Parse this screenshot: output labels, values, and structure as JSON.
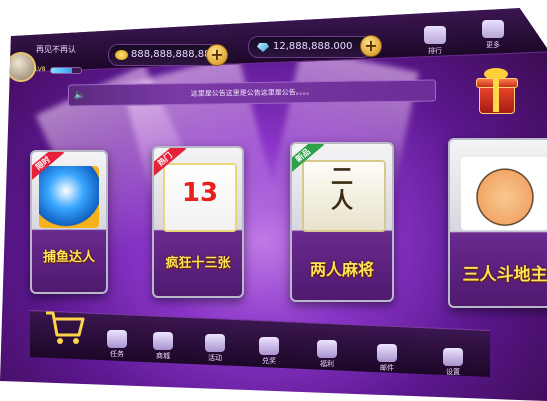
{
  "player": {
    "name": "再见不再认",
    "level_label": "LV8",
    "level_progress": 0.7
  },
  "currency": {
    "gold": "888,888,888,888",
    "diamonds": "12,888,888.000",
    "plus_label": "+"
  },
  "top_icons": [
    {
      "icon": "crown-icon",
      "label": "排行"
    },
    {
      "icon": "user-icon",
      "label": "更多"
    }
  ],
  "notice": {
    "text": "这里是公告这里是公告这里是公告。。。。"
  },
  "games": [
    {
      "tag": "限时",
      "title": "捕鱼达人",
      "icon": "fish-icon"
    },
    {
      "tag": "热门",
      "title": "疯狂十三张",
      "icon": "playing-card-icon"
    },
    {
      "tag": "新品",
      "title": "两人麻将",
      "icon": "mahjong-tile-icon"
    },
    {
      "tag": "",
      "title": "三人斗地主",
      "icon": "character-face-icon"
    }
  ],
  "bottom_nav": [
    {
      "icon": "task-icon",
      "label": "任务"
    },
    {
      "icon": "shop-icon",
      "label": "商城"
    },
    {
      "icon": "gift-icon",
      "label": "活动"
    },
    {
      "icon": "medal-icon",
      "label": "兑奖"
    },
    {
      "icon": "bag-icon",
      "label": "福利"
    },
    {
      "icon": "mail-icon",
      "label": "邮件"
    },
    {
      "icon": "gear-icon",
      "label": "设置"
    }
  ],
  "colors": {
    "accent_gold": "#ffe35a",
    "bg_purple": "#8a35c9",
    "bar_dark": "#1c0828"
  }
}
